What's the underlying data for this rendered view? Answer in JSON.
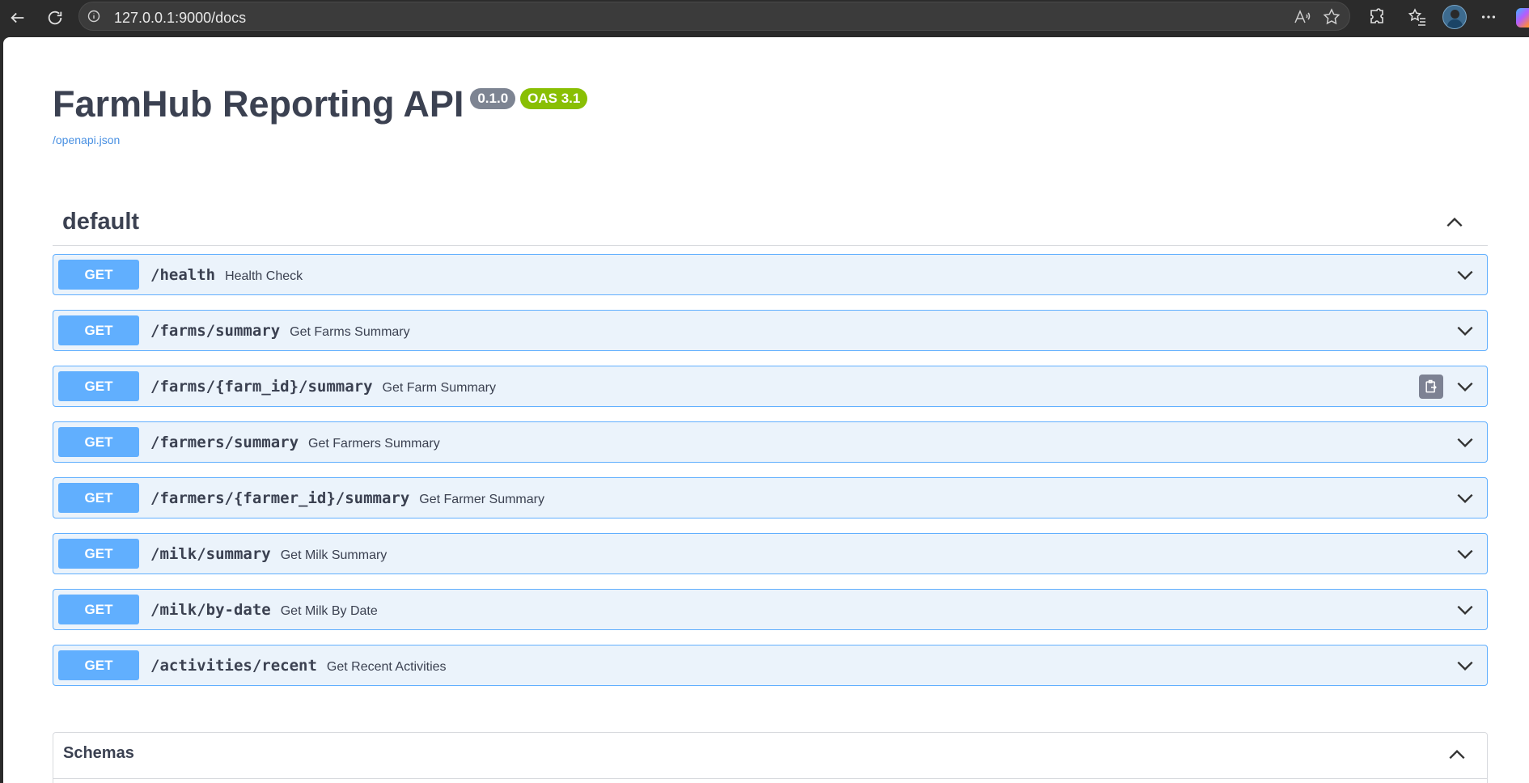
{
  "browser": {
    "url": "127.0.0.1:9000/docs"
  },
  "api": {
    "title": "FarmHub Reporting API",
    "version": "0.1.0",
    "oas": "OAS 3.1",
    "spec_link": "/openapi.json"
  },
  "tag": {
    "name": "default"
  },
  "operations": [
    {
      "method": "GET",
      "path": "/health",
      "summary": "Health Check"
    },
    {
      "method": "GET",
      "path": "/farms/summary",
      "summary": "Get Farms Summary"
    },
    {
      "method": "GET",
      "path": "/farms/{farm_id}/summary",
      "summary": "Get Farm Summary"
    },
    {
      "method": "GET",
      "path": "/farmers/summary",
      "summary": "Get Farmers Summary"
    },
    {
      "method": "GET",
      "path": "/farmers/{farmer_id}/summary",
      "summary": "Get Farmer Summary"
    },
    {
      "method": "GET",
      "path": "/milk/summary",
      "summary": "Get Milk Summary"
    },
    {
      "method": "GET",
      "path": "/milk/by-date",
      "summary": "Get Milk By Date"
    },
    {
      "method": "GET",
      "path": "/activities/recent",
      "summary": "Get Recent Activities"
    }
  ],
  "schemas": {
    "title": "Schemas"
  },
  "colors": {
    "get_method": "#61affe",
    "get_bg": "#ebf3fb",
    "oas_badge": "#89bf04",
    "version_badge": "#7d8492",
    "link": "#4990e2"
  }
}
